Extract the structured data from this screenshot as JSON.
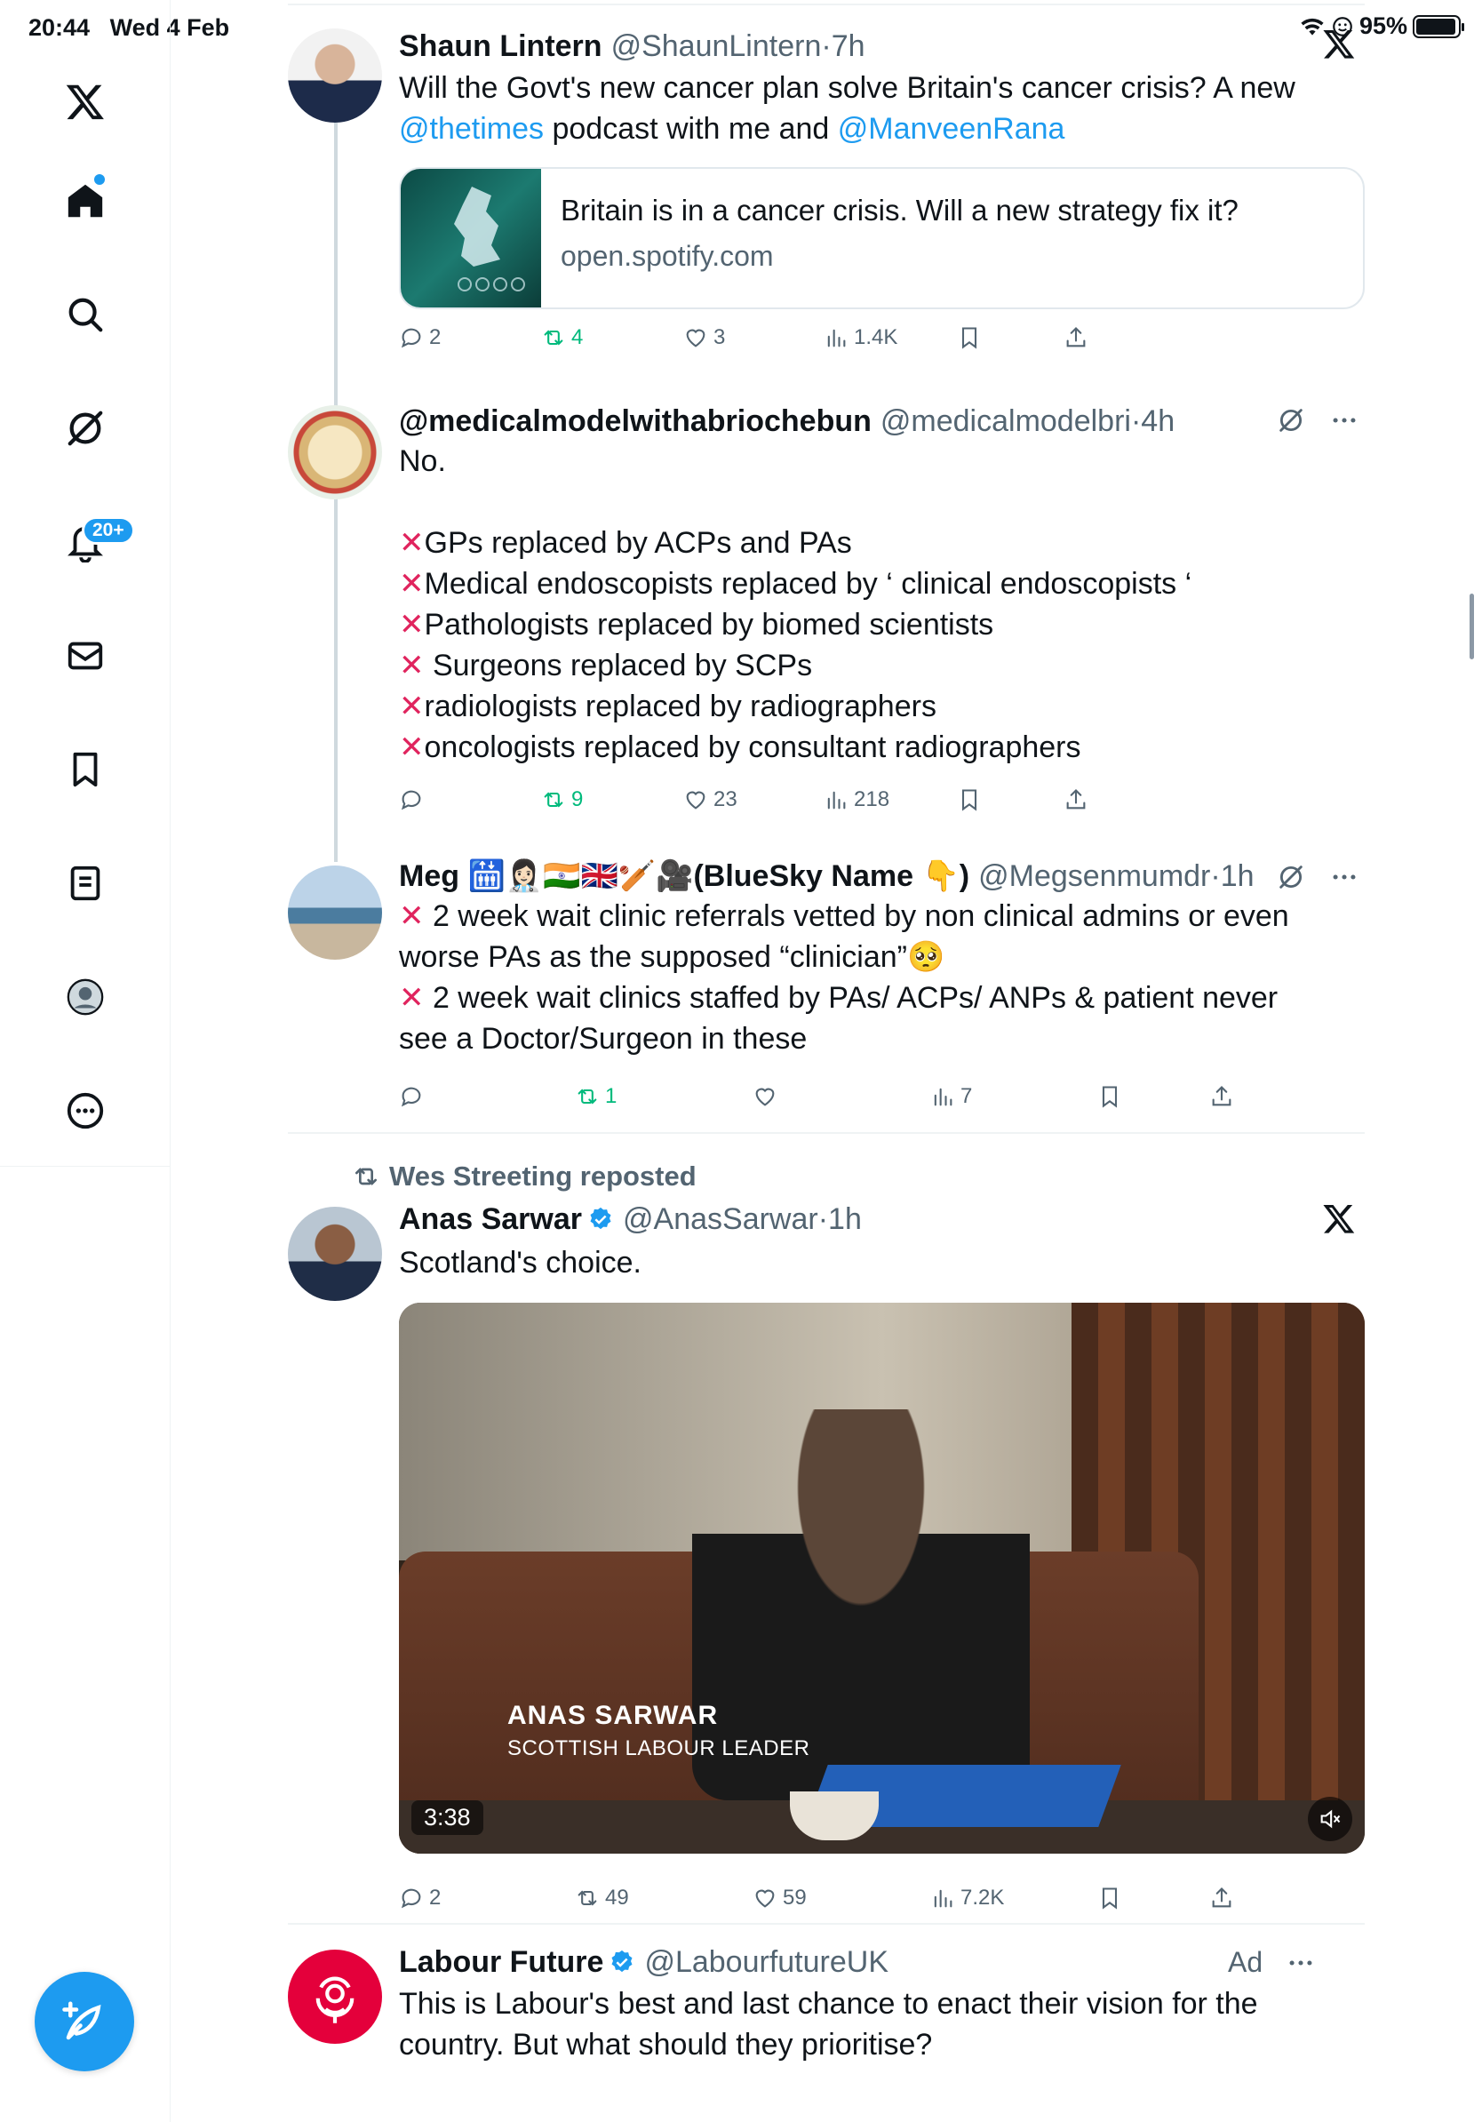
{
  "status_bar": {
    "time": "20:44",
    "date": "Wed 4 Feb",
    "battery": "95%",
    "battery_level": 0.95
  },
  "sidebar": {
    "items": [
      {
        "name": "x-logo-icon"
      },
      {
        "name": "home-icon"
      },
      {
        "name": "search-icon"
      },
      {
        "name": "grok-icon"
      },
      {
        "name": "notifications-icon"
      },
      {
        "name": "messages-icon"
      },
      {
        "name": "bookmarks-icon"
      },
      {
        "name": "lists-icon"
      },
      {
        "name": "profile-icon"
      },
      {
        "name": "more-icon"
      }
    ],
    "notification_badge": "20+",
    "compose_label": "Post"
  },
  "tweets": [
    {
      "name": "Shaun Lintern",
      "handle": "@ShaunLintern",
      "sep": "·",
      "time": "7h",
      "text_1": "Will the Govt's new cancer plan solve Britain's cancer crisis? A new",
      "mention_1": "@thetimes",
      "text_2": " podcast with me and ",
      "mention_2": "@ManveenRana",
      "card": {
        "title": "Britain is in a cancer crisis. Will a new strategy fix it?",
        "domain": "open.spotify.com"
      },
      "replies": "2",
      "reposts": "4",
      "likes": "3",
      "views": "1.4K"
    },
    {
      "name": "@medicalmodelwithabriochebun",
      "handle": "@medicalmodelbri",
      "sep": "·",
      "time": "4h",
      "lines": [
        "No.",
        "",
        "GPs replaced by ACPs and PAs",
        "Medical endoscopists replaced by ‘ clinical endoscopists ‘",
        "Pathologists replaced by biomed scientists",
        " Surgeons replaced by SCPs",
        "radiologists replaced by radiographers",
        "oncologists replaced by consultant radiographers"
      ],
      "replies": "",
      "reposts": "9",
      "likes": "23",
      "views": "218"
    },
    {
      "name": "Meg 🛗👩🏻‍⚕️🇮🇳🇬🇧🏏🎥(BlueSky Name 👇)",
      "handle": "@Megsenmumdr",
      "sep": "·",
      "time": "1h",
      "line_1": " 2 week wait clinic referrals vetted by non clinical admins or even",
      "line_2": "worse PAs as the supposed “clinician”🥺",
      "line_3": " 2 week wait clinics staffed by PAs/ ACPs/ ANPs & patient never",
      "line_4": "see a Doctor/Surgeon in these",
      "replies": "",
      "reposts": "1",
      "likes": "",
      "views": "7"
    },
    {
      "repost_label": "Wes Streeting reposted",
      "name": "Anas Sarwar",
      "handle": "@AnasSarwar",
      "sep": "·",
      "time": "1h",
      "text": "Scotland's choice.",
      "video": {
        "caption_name": "ANAS SARWAR",
        "caption_role": "SCOTTISH LABOUR LEADER",
        "duration": "3:38"
      },
      "replies": "2",
      "reposts": "49",
      "likes": "59",
      "views": "7.2K"
    },
    {
      "name": "Labour Future",
      "handle": "@LabourfutureUK",
      "ad_label": "Ad",
      "line_1": "This is Labour's best and last chance to enact their vision for the",
      "line_2": "country. But what should they prioritise?"
    }
  ],
  "colors": {
    "accent": "#1d9bf0",
    "repost_green": "#00ba7c",
    "muted": "#536471",
    "cross_red": "#e0245e"
  }
}
